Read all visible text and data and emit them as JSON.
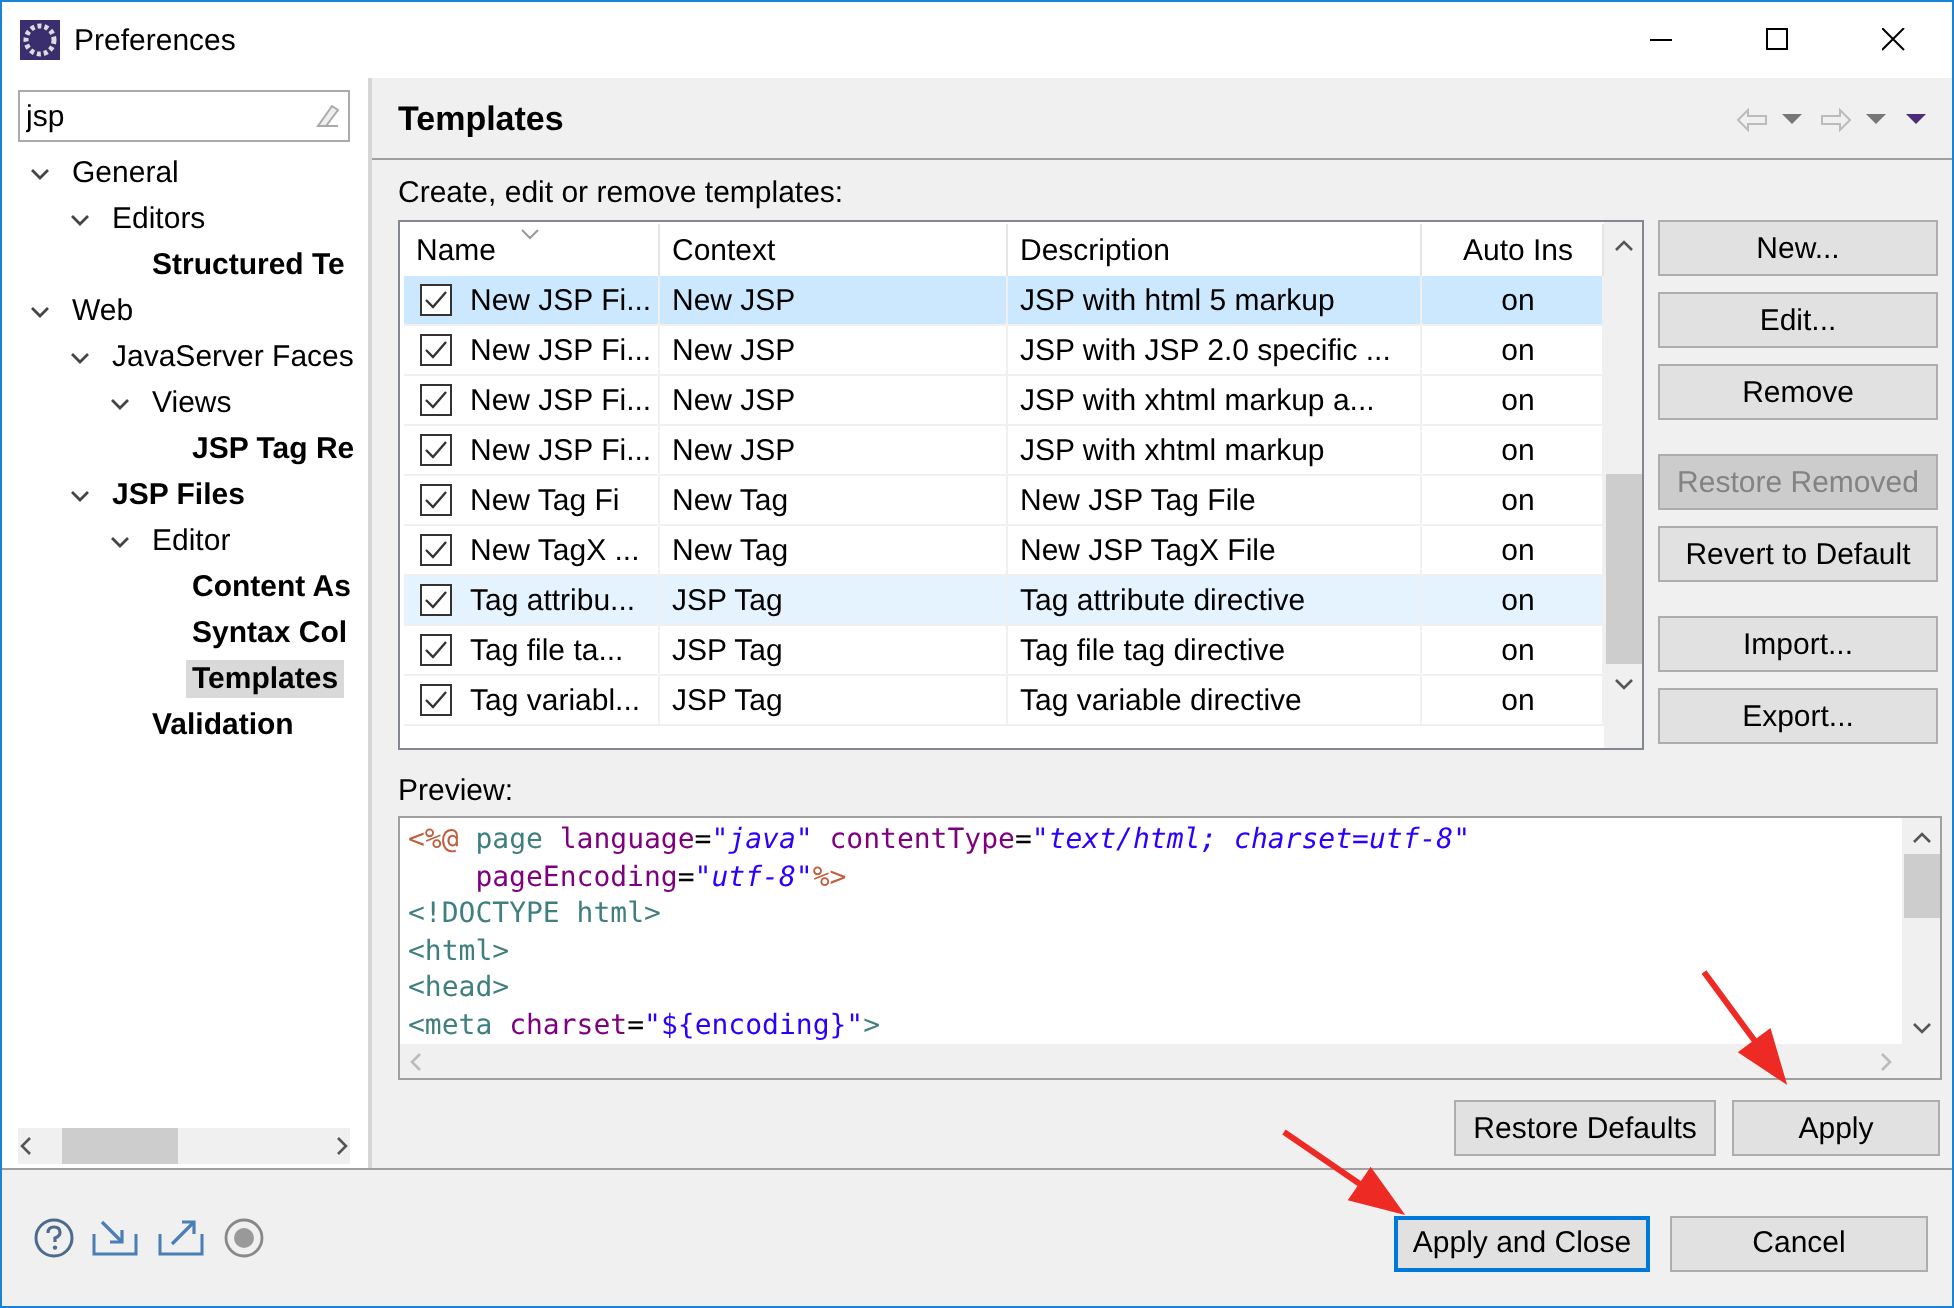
{
  "window": {
    "title": "Preferences"
  },
  "filter": {
    "value": "jsp"
  },
  "tree": [
    {
      "label": "General",
      "expanded": true,
      "bold": false,
      "selected": false,
      "children": [
        {
          "label": "Editors",
          "expanded": true,
          "bold": false,
          "selected": false,
          "children": [
            {
              "label": "Structured Te",
              "bold": true,
              "selected": false
            }
          ]
        }
      ]
    },
    {
      "label": "Web",
      "expanded": true,
      "bold": false,
      "selected": false,
      "children": [
        {
          "label": "JavaServer Faces",
          "expanded": true,
          "bold": false,
          "selected": false,
          "children": [
            {
              "label": "Views",
              "expanded": true,
              "bold": false,
              "selected": false,
              "children": [
                {
                  "label": "JSP Tag Re",
                  "bold": true,
                  "selected": false
                }
              ]
            }
          ]
        },
        {
          "label": "JSP Files",
          "expanded": true,
          "bold": true,
          "selected": false,
          "children": [
            {
              "label": "Editor",
              "expanded": true,
              "bold": false,
              "selected": false,
              "children": [
                {
                  "label": "Content As",
                  "bold": true,
                  "selected": false
                },
                {
                  "label": "Syntax Col",
                  "bold": true,
                  "selected": false
                },
                {
                  "label": "Templates",
                  "bold": true,
                  "selected": true
                }
              ]
            },
            {
              "label": "Validation",
              "bold": true,
              "selected": false
            }
          ]
        }
      ]
    }
  ],
  "page": {
    "title": "Templates",
    "description": "Create, edit or remove templates:"
  },
  "table": {
    "columns": [
      "Name",
      "Context",
      "Description",
      "Auto Ins"
    ],
    "rows": [
      {
        "checked": true,
        "selected": true,
        "hovered": false,
        "cells": [
          "New JSP Fi...",
          "New JSP",
          "JSP with html 5 markup",
          "on"
        ]
      },
      {
        "checked": true,
        "selected": false,
        "hovered": false,
        "cells": [
          "New JSP Fi...",
          "New JSP",
          "JSP with JSP 2.0 specific ...",
          "on"
        ]
      },
      {
        "checked": true,
        "selected": false,
        "hovered": false,
        "cells": [
          "New JSP Fi...",
          "New JSP",
          "JSP with xhtml markup a...",
          "on"
        ]
      },
      {
        "checked": true,
        "selected": false,
        "hovered": false,
        "cells": [
          "New JSP Fi...",
          "New JSP",
          "JSP with xhtml markup",
          "on"
        ]
      },
      {
        "checked": true,
        "selected": false,
        "hovered": false,
        "cells": [
          "New Tag Fi",
          "New Tag",
          "New JSP Tag File",
          "on"
        ]
      },
      {
        "checked": true,
        "selected": false,
        "hovered": false,
        "cells": [
          "New TagX ...",
          "New Tag",
          "New JSP TagX File",
          "on"
        ]
      },
      {
        "checked": true,
        "selected": false,
        "hovered": true,
        "cells": [
          "Tag attribu...",
          "JSP Tag",
          "Tag attribute directive",
          "on"
        ]
      },
      {
        "checked": true,
        "selected": false,
        "hovered": false,
        "cells": [
          "Tag file ta...",
          "JSP Tag",
          "Tag file tag directive",
          "on"
        ]
      },
      {
        "checked": true,
        "selected": false,
        "hovered": false,
        "cells": [
          "Tag variabl...",
          "JSP Tag",
          "Tag variable directive",
          "on"
        ]
      }
    ]
  },
  "button_groups": [
    [
      {
        "label": "New...",
        "disabled": false
      },
      {
        "label": "Edit...",
        "disabled": false
      },
      {
        "label": "Remove",
        "disabled": false
      }
    ],
    [
      {
        "label": "Restore Removed",
        "disabled": true
      },
      {
        "label": "Revert to Default",
        "disabled": false
      }
    ],
    [
      {
        "label": "Import...",
        "disabled": false
      },
      {
        "label": "Export...",
        "disabled": false
      }
    ]
  ],
  "preview": {
    "label": "Preview:",
    "lines": [
      {
        "indent": false,
        "tokens": [
          {
            "kind": "delim",
            "text": "<%@"
          },
          {
            "kind": "tag",
            "text": "page",
            "space_before": true
          },
          {
            "kind": "attr",
            "text": "language",
            "space_before": true
          },
          {
            "kind": "plain",
            "text": "="
          },
          {
            "kind": "string",
            "text": "\"java\""
          },
          {
            "kind": "attr",
            "text": "contentType",
            "space_before": true
          },
          {
            "kind": "plain",
            "text": "="
          },
          {
            "kind": "string",
            "text": "\"text/html; charset=utf-8\""
          }
        ]
      },
      {
        "indent": true,
        "tokens": [
          {
            "kind": "attr",
            "text": "pageEncoding"
          },
          {
            "kind": "plain",
            "text": "="
          },
          {
            "kind": "string",
            "text": "\"utf-8\""
          },
          {
            "kind": "delim",
            "text": "%>"
          }
        ]
      },
      {
        "indent": false,
        "tokens": [
          {
            "kind": "tag",
            "text": "<!DOCTYPE html>"
          }
        ]
      },
      {
        "indent": false,
        "tokens": [
          {
            "kind": "tag",
            "text": "<html>"
          }
        ]
      },
      {
        "indent": false,
        "tokens": [
          {
            "kind": "tag",
            "text": "<head>"
          }
        ]
      },
      {
        "indent": false,
        "tokens": [
          {
            "kind": "tag",
            "text": "<meta"
          },
          {
            "kind": "attr",
            "text": "charset",
            "space_before": true
          },
          {
            "kind": "plain",
            "text": "="
          },
          {
            "kind": "string2",
            "text": "\"${encoding}\""
          },
          {
            "kind": "tag",
            "text": ">"
          }
        ]
      }
    ]
  },
  "page_buttons": [
    {
      "label": "Restore Defaults",
      "default": false
    },
    {
      "label": "Apply",
      "default": false
    }
  ],
  "dialog_buttons": [
    {
      "label": "Apply and Close",
      "default": true
    },
    {
      "label": "Cancel",
      "default": false
    }
  ]
}
